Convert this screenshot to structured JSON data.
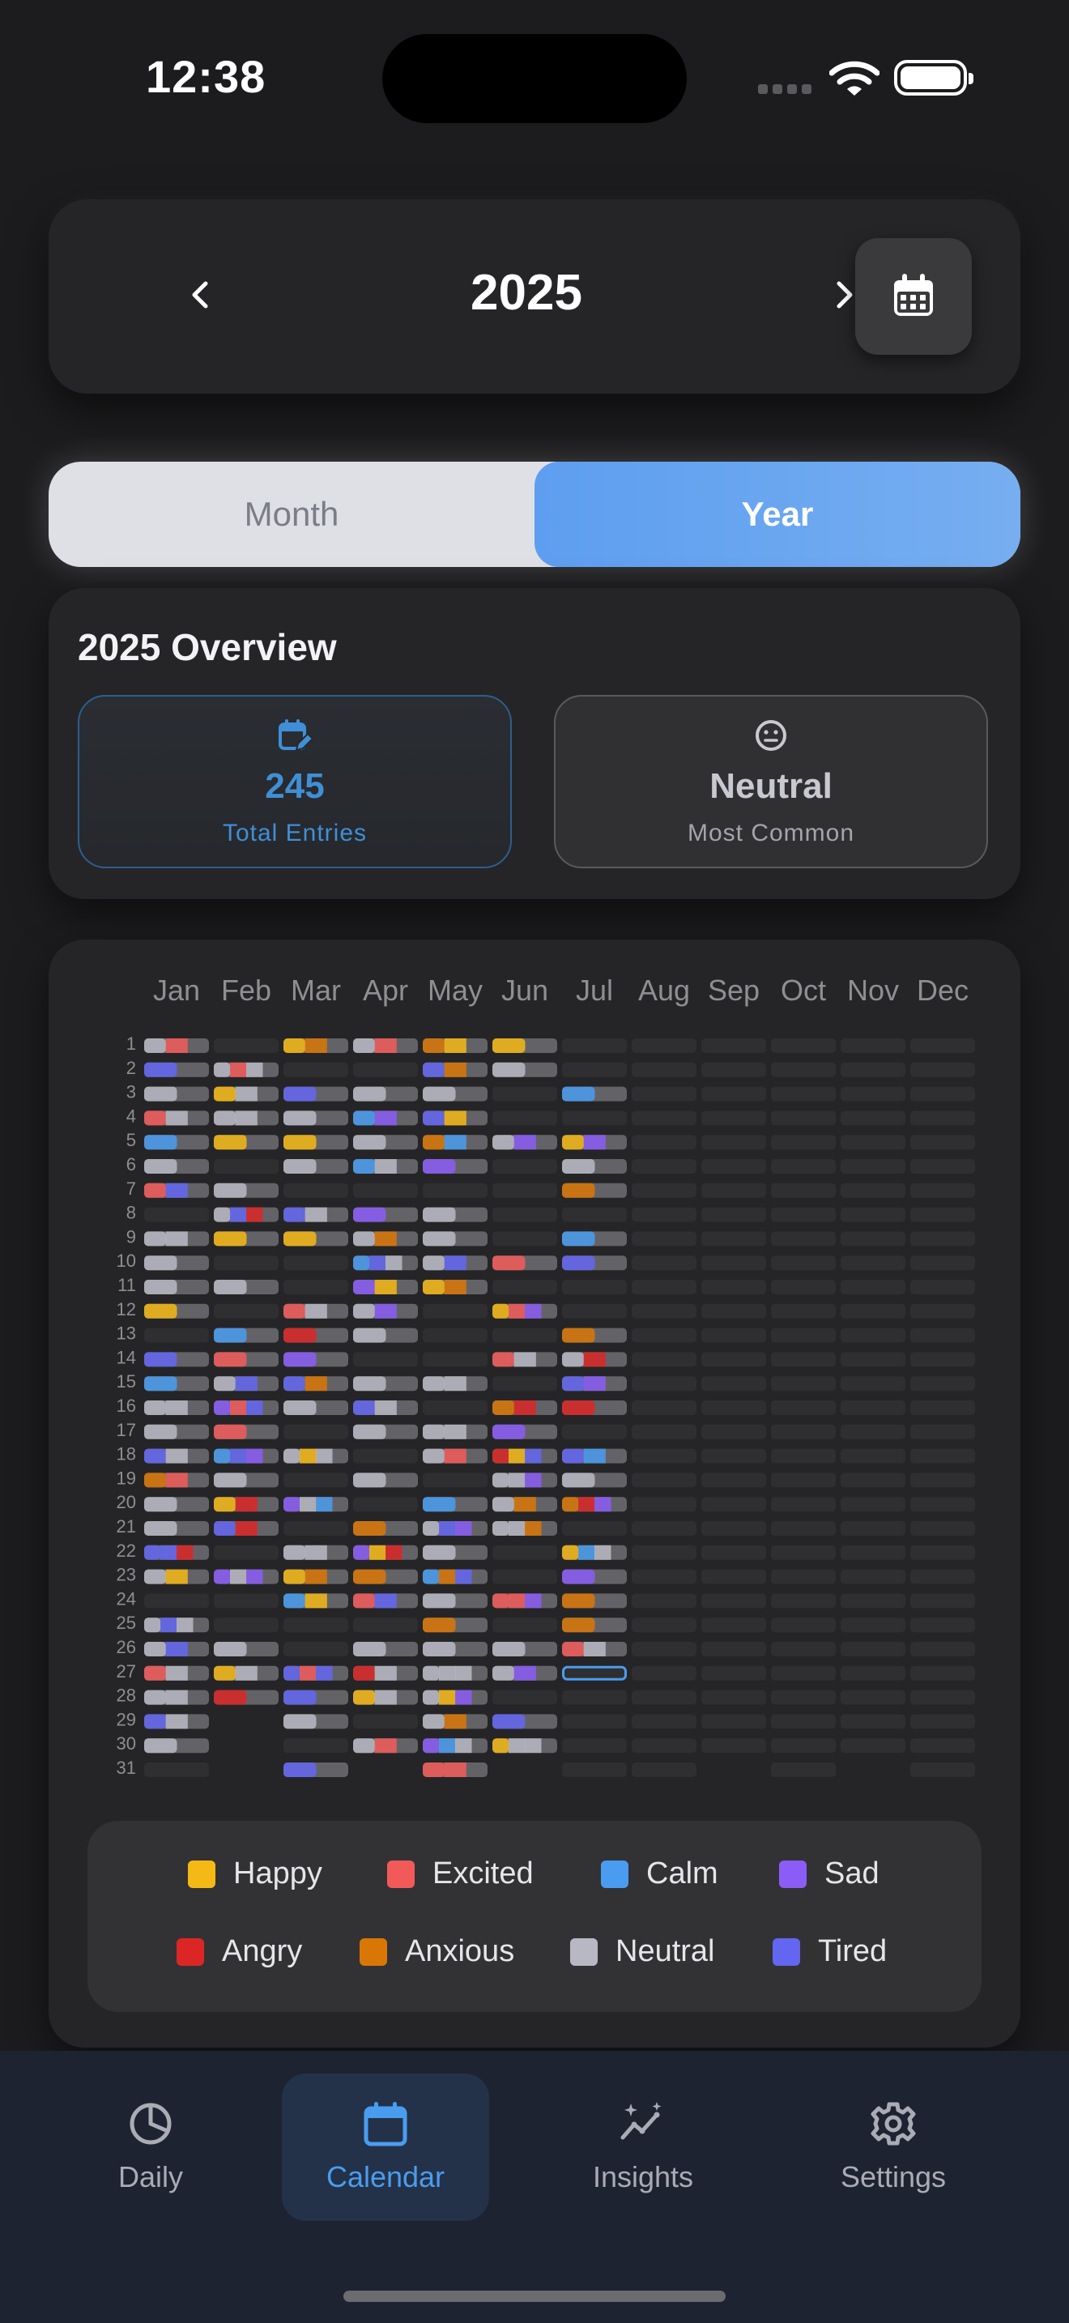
{
  "status": {
    "time": "12:38"
  },
  "header": {
    "year": "2025"
  },
  "view_toggle": {
    "options": [
      "Month",
      "Year"
    ],
    "selected": "Year"
  },
  "overview": {
    "title": "2025 Overview",
    "total_entries": "245",
    "total_entries_label": "Total Entries",
    "most_common": "Neutral",
    "most_common_label": "Most Common"
  },
  "heatmap": {
    "months": [
      "Jan",
      "Feb",
      "Mar",
      "Apr",
      "May",
      "Jun",
      "Jul",
      "Aug",
      "Sep",
      "Oct",
      "Nov",
      "Dec"
    ],
    "days": [
      "1",
      "2",
      "3",
      "4",
      "5",
      "6",
      "7",
      "8",
      "9",
      "10",
      "11",
      "12",
      "13",
      "14",
      "15",
      "16",
      "17",
      "18",
      "19",
      "20",
      "21",
      "22",
      "23",
      "24",
      "25",
      "26",
      "27",
      "28",
      "29",
      "30",
      "31"
    ],
    "today": {
      "month": "Jul",
      "day": 27
    },
    "empty_color": "#2f2f31"
  },
  "legend": [
    {
      "label": "Happy",
      "color": "#f5b915"
    },
    {
      "label": "Excited",
      "color": "#f25a5a"
    },
    {
      "label": "Calm",
      "color": "#4a9cf0"
    },
    {
      "label": "Sad",
      "color": "#8b5cf6"
    },
    {
      "label": "Angry",
      "color": "#dc2626"
    },
    {
      "label": "Anxious",
      "color": "#d97706"
    },
    {
      "label": "Neutral",
      "color": "#b8b8c4"
    },
    {
      "label": "Tired",
      "color": "#6366f1"
    }
  ],
  "tabs": [
    {
      "label": "Daily",
      "icon": "pie-chart-icon"
    },
    {
      "label": "Calendar",
      "icon": "calendar-icon",
      "active": true
    },
    {
      "label": "Insights",
      "icon": "sparkle-trend-icon"
    },
    {
      "label": "Settings",
      "icon": "gear-icon"
    }
  ]
}
